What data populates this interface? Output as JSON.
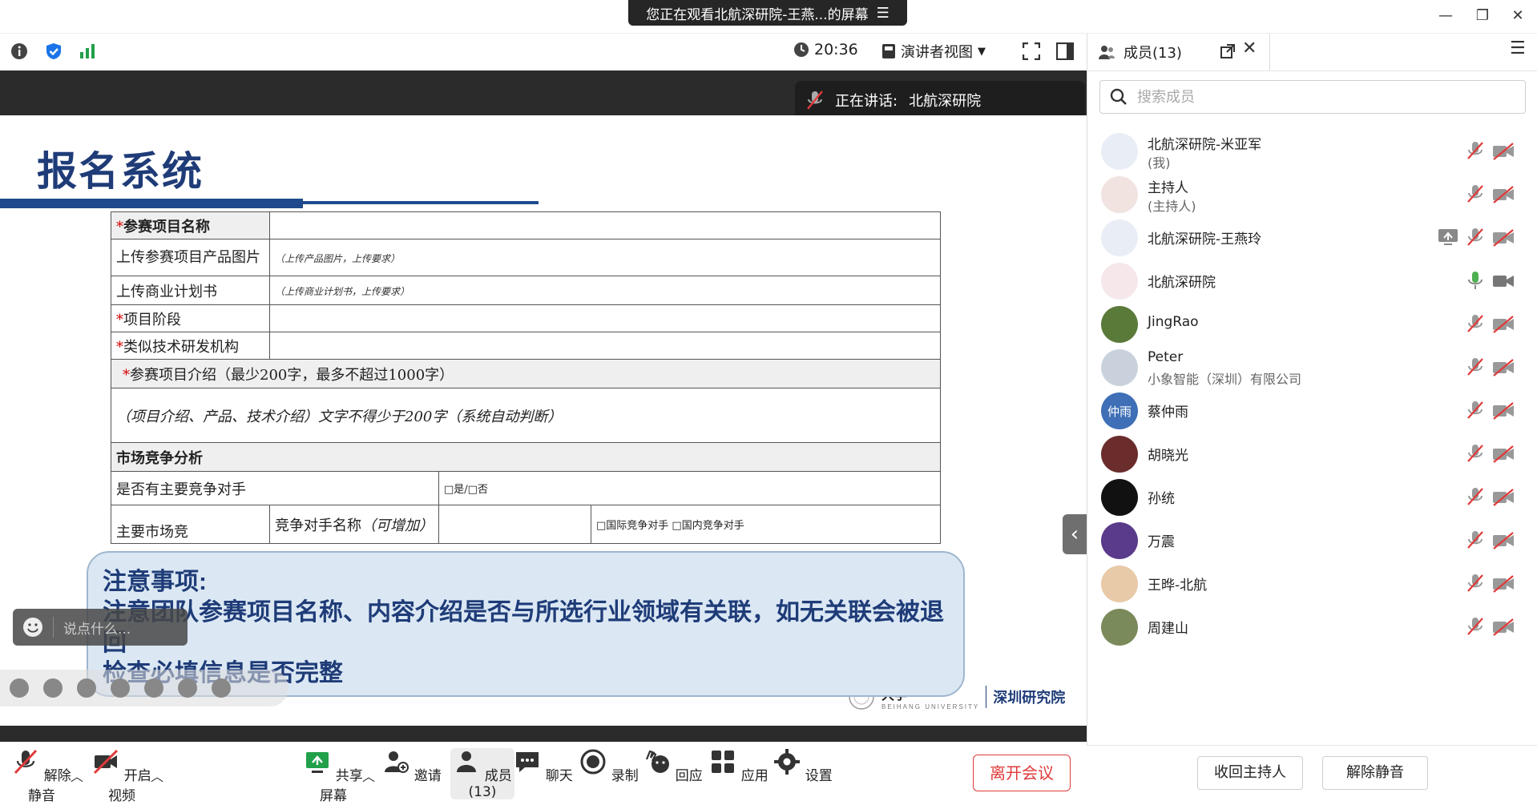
{
  "titlebar": {
    "banner_text": "您正在观看北航深研院-王燕...的屏幕",
    "banner_menu_icon": "menu-lines-icon"
  },
  "toolbar": {
    "timer": "20:36",
    "view_mode": "演讲者视图"
  },
  "speaker": {
    "label": "正在讲话:",
    "name": "北航深研院"
  },
  "slide": {
    "title": "报名系统",
    "rows": {
      "project_name": "参赛项目名称",
      "upload_image": "上传参赛项目产品图片",
      "upload_image_hint": "（上传产品图片，上传要求）",
      "upload_plan": "上传商业计划书",
      "upload_plan_hint": "（上传商业计划书，上传要求）",
      "stage": "项目阶段",
      "similar_org": "类似技术研发机构",
      "intro_header": "参赛项目介绍（最少200字，最多不超过1000字）",
      "intro_hint": "（项目介绍、产品、技术介绍）文字不得少于200字（系统自动判断）",
      "market_header": "市场竞争分析",
      "has_competitor": "是否有主要竞争对手",
      "has_competitor_options": "□是/□否",
      "main_competitor": "主要市场竞",
      "competitor_name": "竞争对手名称",
      "competitor_name_note": "（可增加）",
      "competitor_type_options": "□国际竞争对手 □国内竞争对手"
    },
    "notice": {
      "heading": "注意事项:",
      "line1": "注意团队参赛项目名称、内容介绍是否与所选行业领域有关联，如无关联会被退回",
      "line2": "检查必填信息是否完整"
    },
    "logo_text_left": "大学",
    "logo_text_right": "深圳研究院",
    "logo_subtext": "BEIHANG UNIVERSITY"
  },
  "chat_input": {
    "placeholder": "说点什么..."
  },
  "bottombar": {
    "unmute": "解除静音",
    "start_video": "开启视频",
    "share": "共享屏幕",
    "invite": "邀请",
    "members": "成员(13)",
    "chat": "聊天",
    "record": "录制",
    "reaction": "回应",
    "apps": "应用",
    "settings": "设置",
    "leave": "离开会议"
  },
  "panel": {
    "tab_label": "成员(13)",
    "search_placeholder": "搜索成员",
    "members": [
      {
        "name": "北航深研院-米亚军",
        "sub": "(我)",
        "mic": "muted",
        "cam": "off"
      },
      {
        "name": "主持人",
        "sub": "(主持人)",
        "mic": "muted",
        "cam": "off"
      },
      {
        "name": "北航深研院-王燕玲",
        "sub": "",
        "mic": "muted",
        "cam": "off",
        "sharing": true
      },
      {
        "name": "北航深研院",
        "sub": "",
        "mic": "active",
        "cam": "on"
      },
      {
        "name": "JingRao",
        "sub": "",
        "mic": "muted",
        "cam": "off"
      },
      {
        "name": "Peter",
        "sub": "小象智能（深圳）有限公司",
        "mic": "muted",
        "cam": "off"
      },
      {
        "name": "蔡仲雨",
        "sub": "",
        "avatar_text": "仲雨",
        "mic": "muted",
        "cam": "off"
      },
      {
        "name": "胡晓光",
        "sub": "",
        "mic": "muted",
        "cam": "off"
      },
      {
        "name": "孙统",
        "sub": "",
        "mic": "muted",
        "cam": "off"
      },
      {
        "name": "万震",
        "sub": "",
        "mic": "muted",
        "cam": "off"
      },
      {
        "name": "王晔-北航",
        "sub": "",
        "mic": "muted",
        "cam": "off"
      },
      {
        "name": "周建山",
        "sub": "",
        "mic": "muted",
        "cam": "off"
      }
    ],
    "reclaim_host": "收回主持人",
    "unmute_all": "解除静音"
  },
  "colors": {
    "brand_blue": "#1f3c78",
    "leave_red": "#e03a3a",
    "share_green": "#22a04a",
    "mic_active_green": "#4caf50"
  }
}
